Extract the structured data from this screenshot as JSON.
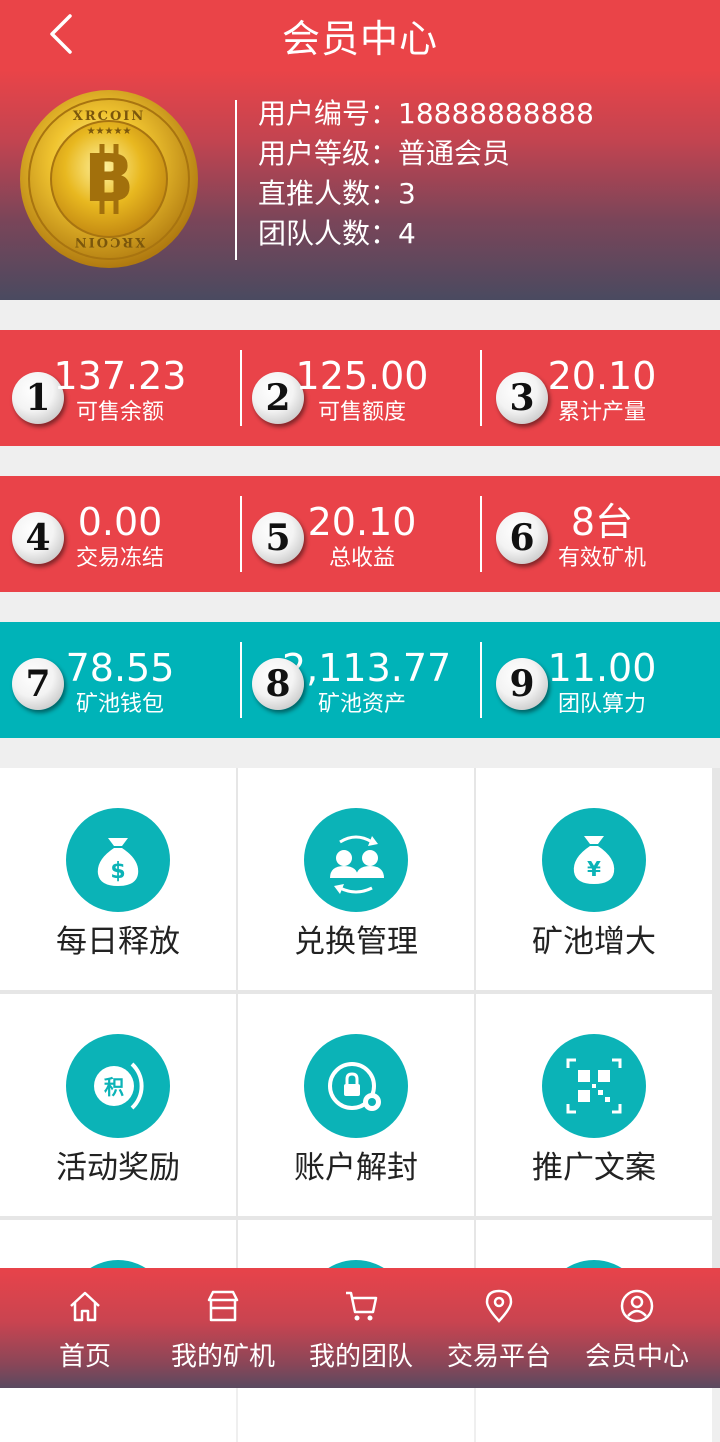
{
  "header": {
    "title": "会员中心",
    "coin_text_top": "XRCOIN",
    "coin_text_bottom": "XRCOIN",
    "info": [
      "用户编号：18888888888",
      "用户等级：普通会员",
      "直推人数：3",
      "团队人数：4"
    ]
  },
  "stats": [
    [
      {
        "num": "1",
        "value": "137.23",
        "label": "可售余额"
      },
      {
        "num": "2",
        "value": "125.00",
        "label": "可售额度"
      },
      {
        "num": "3",
        "value": "20.10",
        "label": "累计产量"
      }
    ],
    [
      {
        "num": "4",
        "value": "0.00",
        "label": "交易冻结"
      },
      {
        "num": "5",
        "value": "20.10",
        "label": "总收益"
      },
      {
        "num": "6",
        "value": "8台",
        "label": "有效矿机"
      }
    ],
    [
      {
        "num": "7",
        "value": "78.55",
        "label": "矿池钱包"
      },
      {
        "num": "8",
        "value": "2,113.77",
        "label": "矿池资产"
      },
      {
        "num": "9",
        "value": "11.00",
        "label": "团队算力"
      }
    ]
  ],
  "menu": [
    {
      "label": "每日释放",
      "icon": "money-bag-dollar-icon"
    },
    {
      "label": "兑换管理",
      "icon": "user-exchange-icon"
    },
    {
      "label": "矿池增大",
      "icon": "money-bag-yuan-icon"
    },
    {
      "label": "活动奖励",
      "icon": "points-icon",
      "icon_text": "积"
    },
    {
      "label": "账户解封",
      "icon": "lock-gear-icon"
    },
    {
      "label": "推广文案",
      "icon": "qr-code-icon"
    }
  ],
  "nav": [
    {
      "label": "首页",
      "icon": "home-icon"
    },
    {
      "label": "我的矿机",
      "icon": "shop-icon"
    },
    {
      "label": "我的团队",
      "icon": "cart-icon"
    },
    {
      "label": "交易平台",
      "icon": "location-icon"
    },
    {
      "label": "会员中心",
      "icon": "user-circle-icon"
    }
  ],
  "colors": {
    "red": "#e94349",
    "teal": "#00b3b8",
    "icon_teal": "#0bb3b7"
  }
}
